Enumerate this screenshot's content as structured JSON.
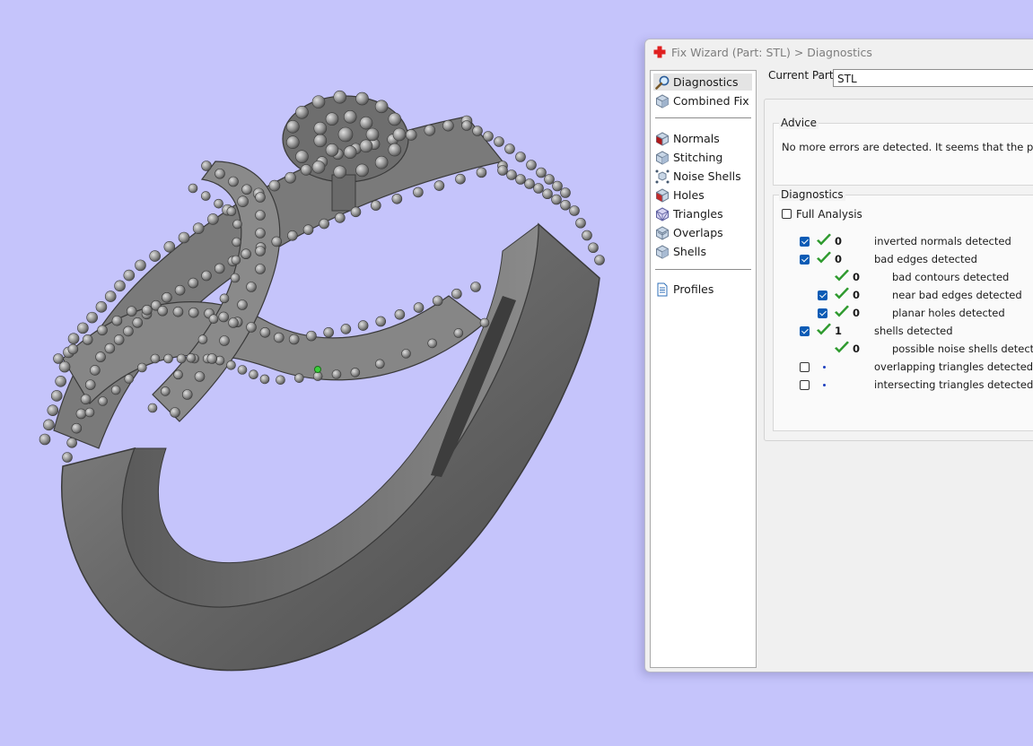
{
  "window": {
    "title": "Fix Wizard (Part: STL) > Diagnostics"
  },
  "nav": {
    "top_items": [
      {
        "label": "Diagnostics",
        "icon": "magnifier-icon",
        "active": true
      },
      {
        "label": "Combined Fix",
        "icon": "cube-icon",
        "active": false
      }
    ],
    "tool_items": [
      {
        "label": "Normals",
        "icon": "normals-cube-icon"
      },
      {
        "label": "Stitching",
        "icon": "stitching-cube-icon"
      },
      {
        "label": "Noise Shells",
        "icon": "noise-shells-icon"
      },
      {
        "label": "Holes",
        "icon": "holes-cube-icon"
      },
      {
        "label": "Triangles",
        "icon": "triangles-cube-icon"
      },
      {
        "label": "Overlaps",
        "icon": "overlaps-cube-icon"
      },
      {
        "label": "Shells",
        "icon": "shells-cube-icon"
      }
    ],
    "bottom_items": [
      {
        "label": "Profiles",
        "icon": "document-icon"
      }
    ]
  },
  "current_part": {
    "label": "Current Part:",
    "value": "STL"
  },
  "advice": {
    "title": "Advice",
    "text": "No more errors are detected. It seems that the part is ok."
  },
  "diagnostics": {
    "title": "Diagnostics",
    "full_analysis_label": "Full Analysis",
    "full_analysis_checked": false,
    "rows": [
      {
        "indent": 0,
        "checked": true,
        "has_checkbox": true,
        "status": "ok",
        "count": "0",
        "label": "inverted normals detected"
      },
      {
        "indent": 0,
        "checked": true,
        "has_checkbox": true,
        "status": "ok",
        "count": "0",
        "label": "bad edges detected"
      },
      {
        "indent": 1,
        "checked": false,
        "has_checkbox": false,
        "status": "ok",
        "count": "0",
        "label": "bad contours detected"
      },
      {
        "indent": 1,
        "checked": true,
        "has_checkbox": true,
        "status": "ok",
        "count": "0",
        "label": "near bad edges detected"
      },
      {
        "indent": 1,
        "checked": true,
        "has_checkbox": true,
        "status": "ok",
        "count": "0",
        "label": "planar holes detected"
      },
      {
        "indent": 0,
        "checked": true,
        "has_checkbox": true,
        "status": "ok",
        "count": "1",
        "label": "shells detected"
      },
      {
        "indent": 1,
        "checked": false,
        "has_checkbox": false,
        "status": "ok",
        "count": "0",
        "label": "possible noise shells detected"
      },
      {
        "indent": 0,
        "checked": false,
        "has_checkbox": true,
        "status": "pending",
        "count": "",
        "label": "overlapping triangles detected"
      },
      {
        "indent": 0,
        "checked": false,
        "has_checkbox": true,
        "status": "pending",
        "count": "",
        "label": "intersecting triangles detected"
      }
    ]
  },
  "colors": {
    "viewport_background": "#c5c4fb",
    "check_green": "#2e9a2e",
    "checkbox_blue": "#0b5bb5",
    "title_icon_red": "#e02020"
  }
}
